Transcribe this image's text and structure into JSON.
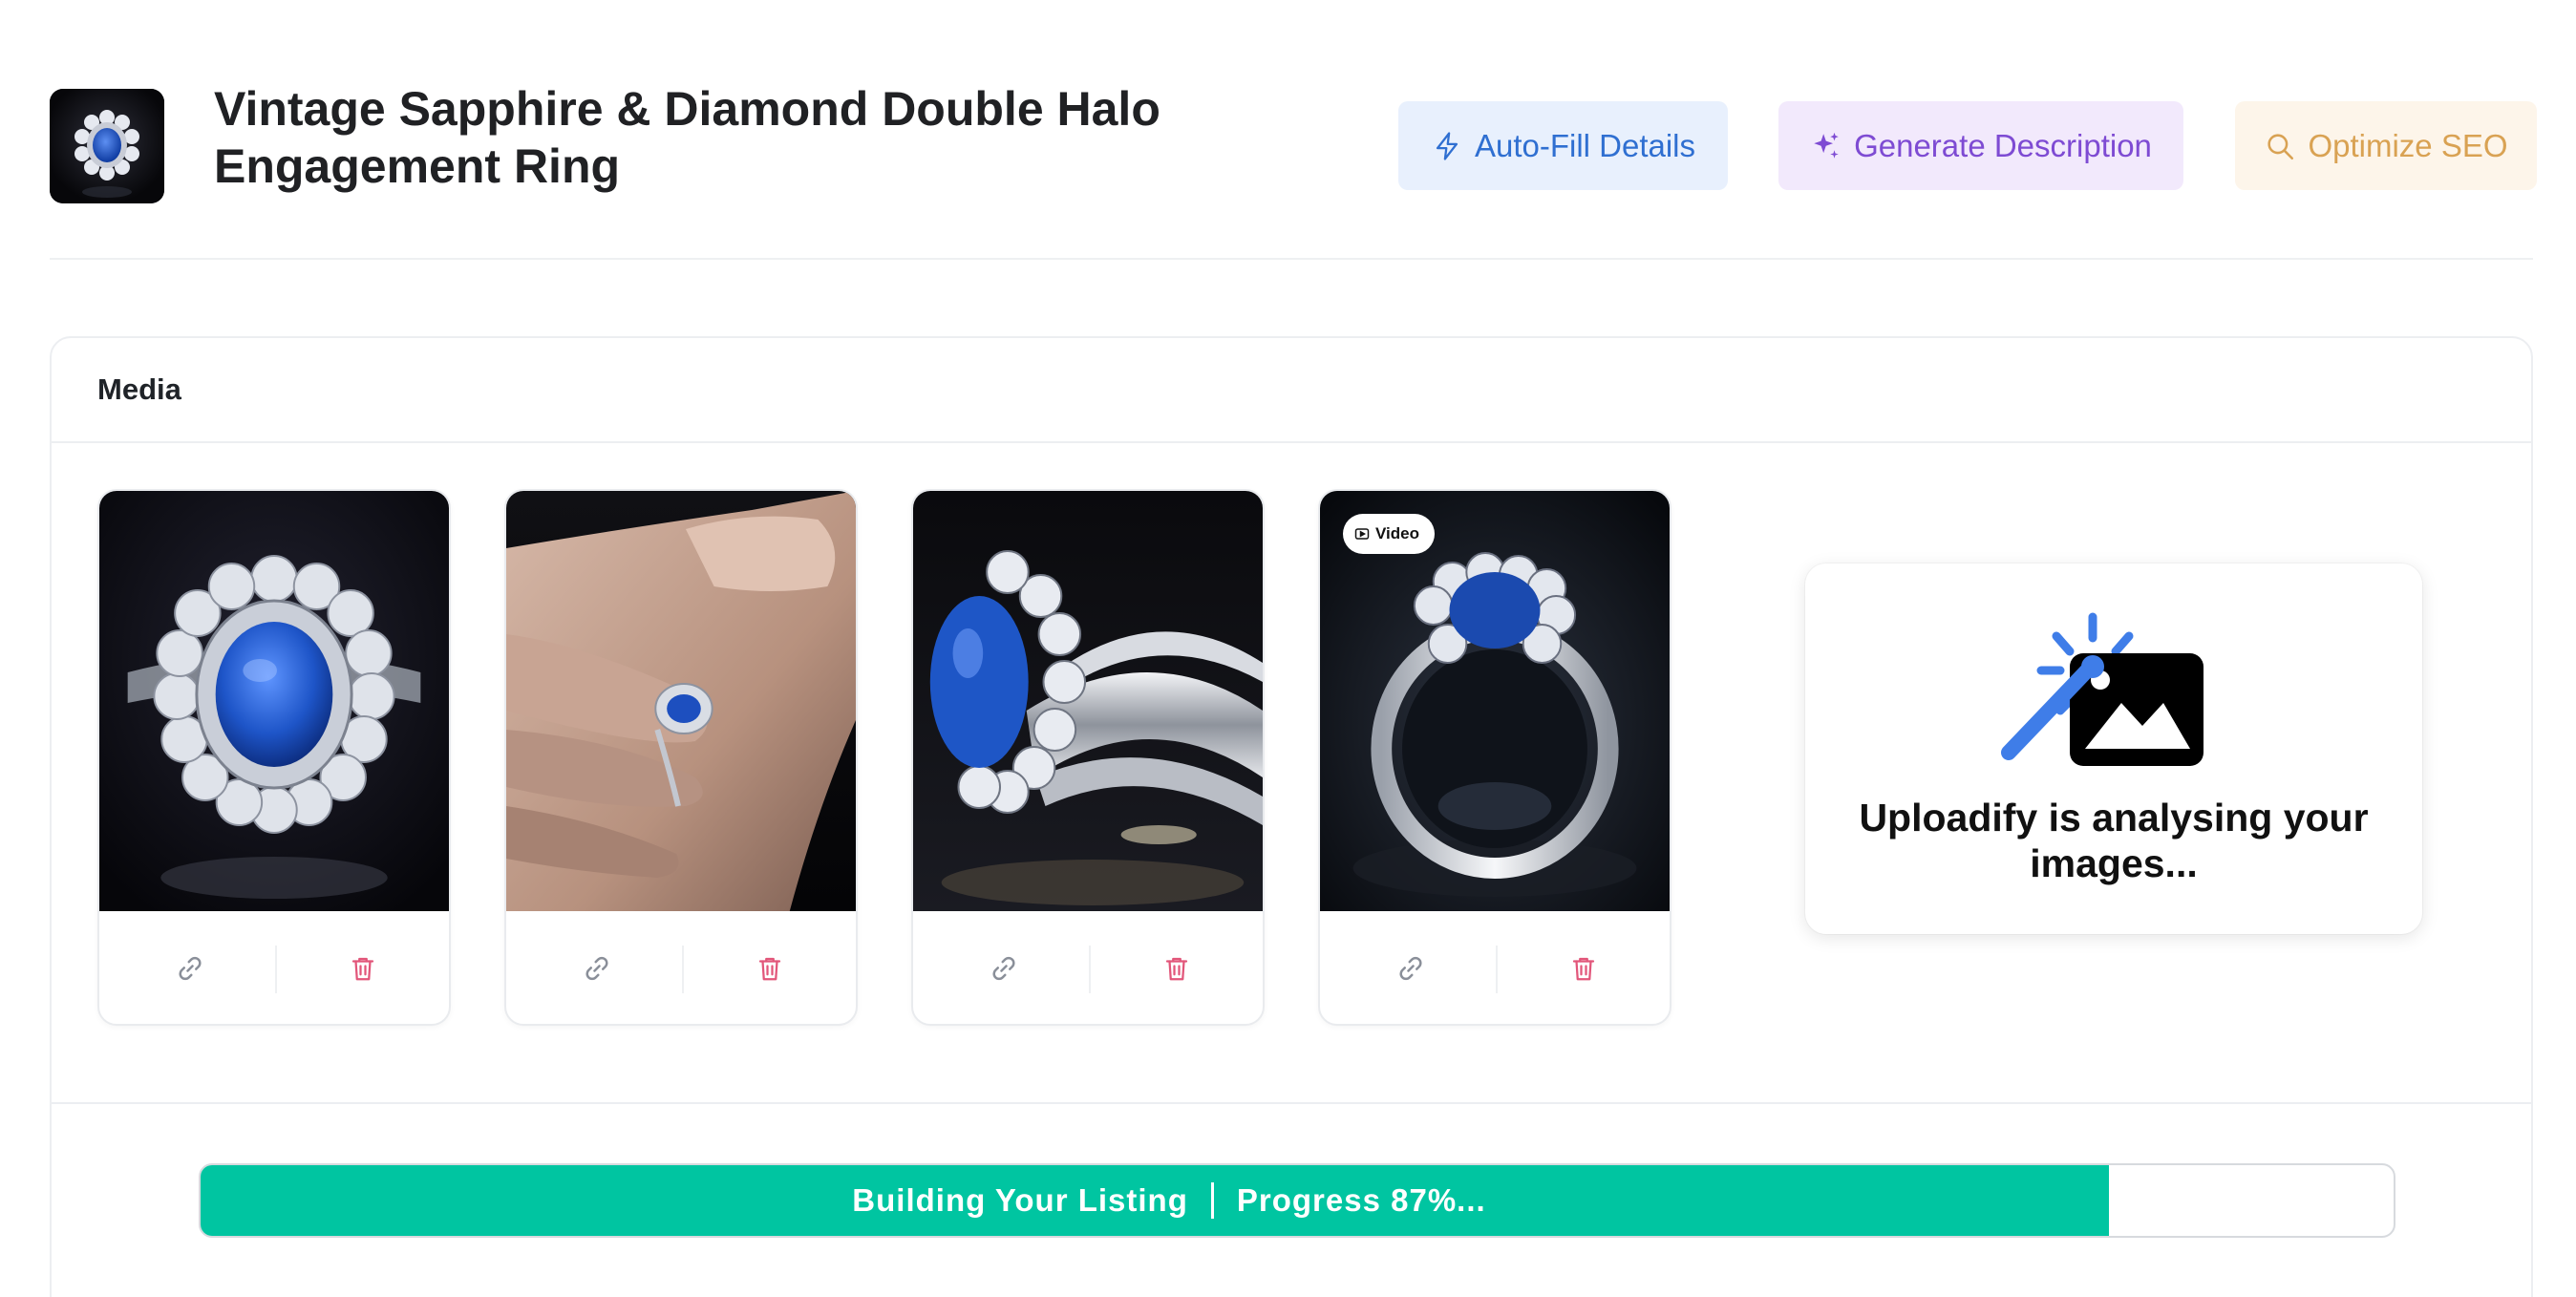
{
  "product": {
    "title": "Vintage Sapphire & Diamond Double Halo Engagement Ring",
    "thumbnail_icon": "ring-thumbnail"
  },
  "actions": {
    "autofill": {
      "label": "Auto-Fill Details",
      "icon": "lightning-icon",
      "color": "#2f6fd1",
      "bg": "#e8f0fd"
    },
    "generate": {
      "label": "Generate Description",
      "icon": "sparkles-icon",
      "color": "#7e4bd3",
      "bg": "#f2e9fc"
    },
    "seo": {
      "label": "Optimize SEO",
      "icon": "search-icon",
      "color": "#d9a253",
      "bg": "#fdf5ea"
    }
  },
  "media": {
    "title": "Media",
    "items": [
      {
        "type": "image",
        "icon": "ring-photo"
      },
      {
        "type": "image",
        "icon": "ring-on-hand-photo"
      },
      {
        "type": "image",
        "icon": "ring-side-photo"
      },
      {
        "type": "video",
        "badge": "Video",
        "icon": "ring-video"
      }
    ],
    "tile_action_icons": [
      "link-icon",
      "trash-icon"
    ],
    "analysis": {
      "message": "Uploadify is analysing your images...",
      "icon": "magic-wand-image-icon"
    }
  },
  "progress": {
    "label": "Building Your Listing",
    "status": "Progress 87%...",
    "value": 0.87,
    "color": "#00c5a1"
  }
}
